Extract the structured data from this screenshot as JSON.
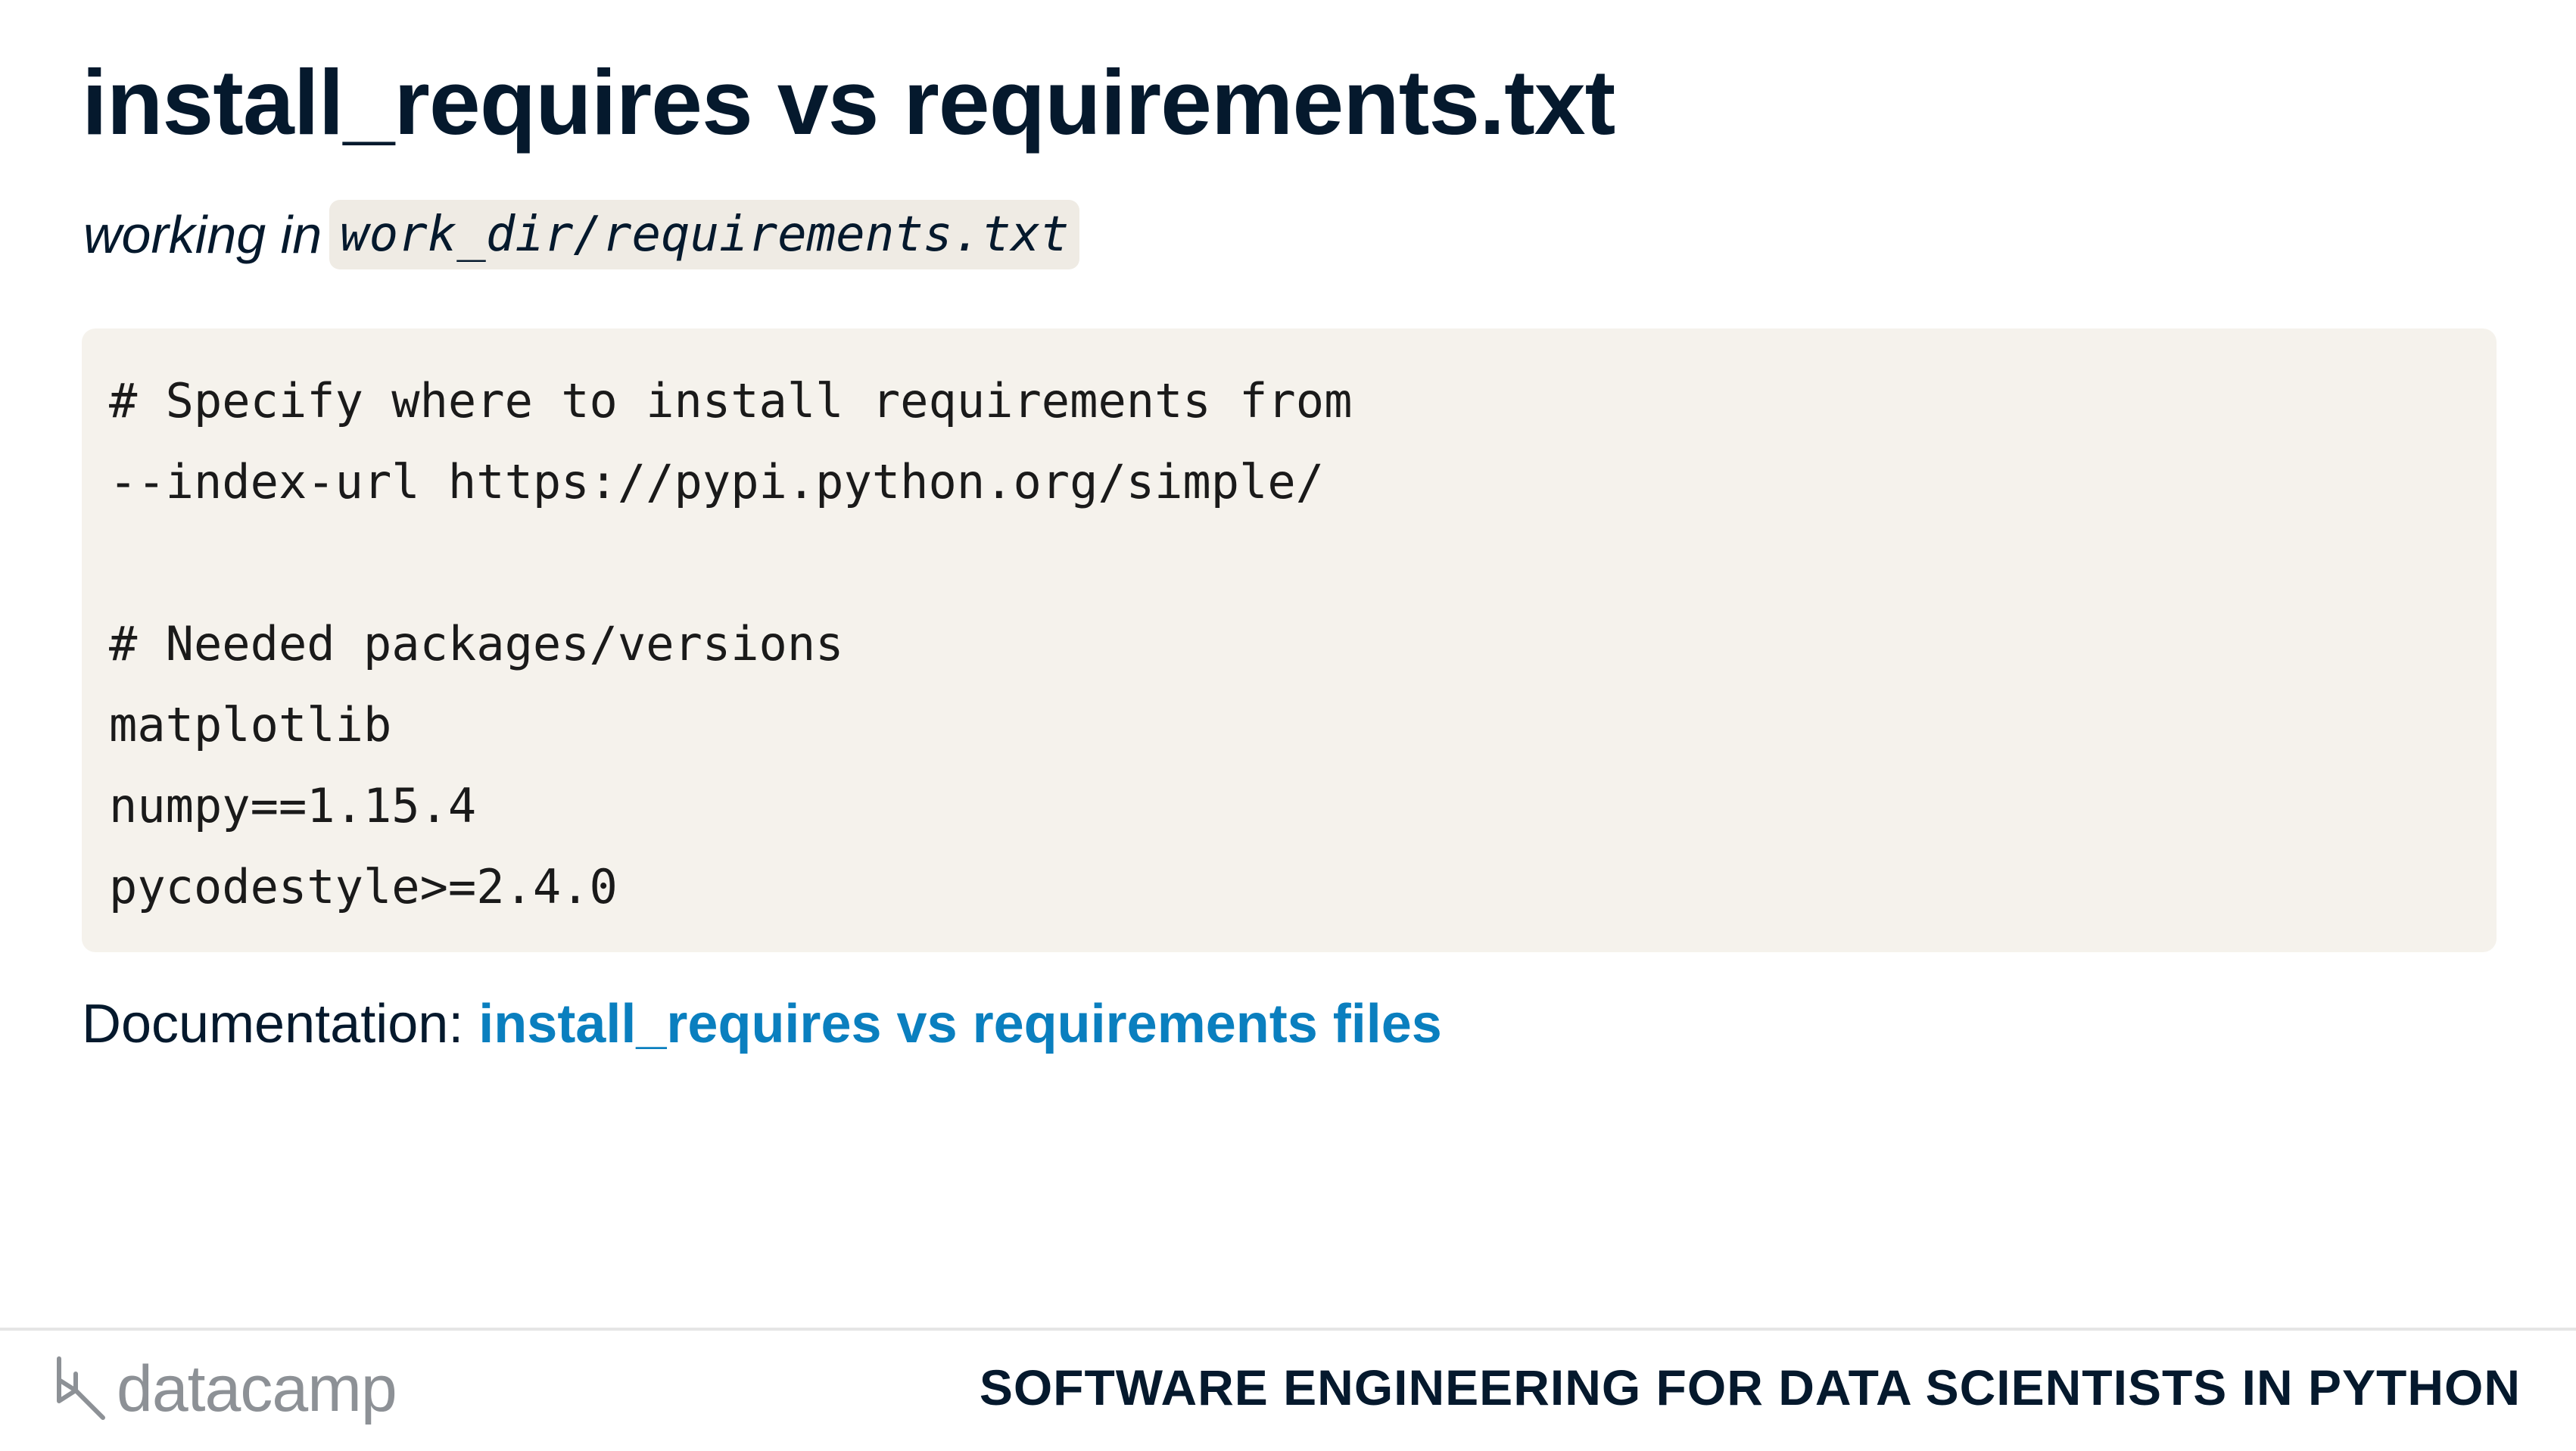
{
  "slide": {
    "title": "install_requires vs requirements.txt",
    "subtitle_prefix": "working in",
    "subtitle_code": "work_dir/requirements.txt"
  },
  "code_block": {
    "lines": [
      "# Specify where to install requirements from",
      "--index-url https://pypi.python.org/simple/",
      "",
      "# Needed packages/versions",
      "matplotlib",
      "numpy==1.15.4",
      "pycodestyle>=2.4.0"
    ]
  },
  "documentation": {
    "label": "Documentation:",
    "link_text": "install_requires vs requirements files"
  },
  "footer": {
    "logo_text": "datacamp",
    "course_name": "SOFTWARE ENGINEERING FOR DATA SCIENTISTS IN PYTHON"
  },
  "colors": {
    "title": "#05192d",
    "link": "#0a7fbf",
    "code_background": "#f5f2ec",
    "logo_gray": "#8d9196"
  }
}
